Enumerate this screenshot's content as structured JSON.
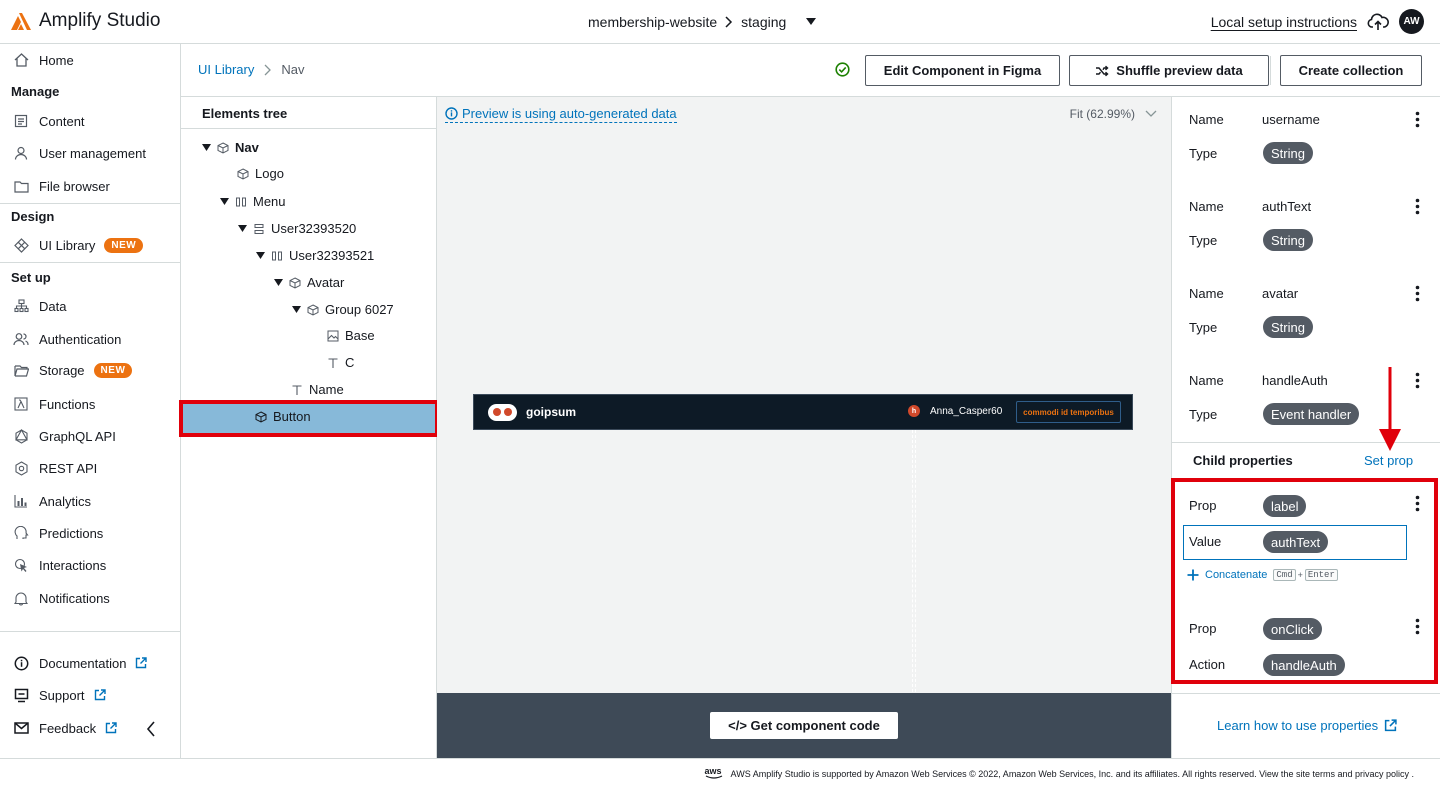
{
  "header": {
    "app_title": "Amplify Studio",
    "project": "membership-website",
    "environment": "staging",
    "setup_link": "Local setup instructions",
    "user_initials": "AW"
  },
  "sidebar": {
    "home": "Home",
    "manage_section": "Manage",
    "manage_items": [
      "Content",
      "User management",
      "File browser"
    ],
    "design_section": "Design",
    "ui_library": "UI Library",
    "ui_library_badge": "NEW",
    "setup_section": "Set up",
    "setup_items": [
      "Data",
      "Authentication",
      "Storage",
      "Functions",
      "GraphQL API",
      "REST API",
      "Analytics",
      "Predictions",
      "Interactions",
      "Notifications"
    ],
    "storage_badge": "NEW",
    "bottom_items": [
      "Documentation",
      "Support",
      "Feedback"
    ]
  },
  "breadcrumb": {
    "root": "UI Library",
    "current": "Nav"
  },
  "toolbar": {
    "edit_figma": "Edit Component in Figma",
    "shuffle": "Shuffle preview data",
    "create_collection": "Create collection"
  },
  "tree": {
    "title": "Elements tree",
    "nodes": [
      "Nav",
      "Logo",
      "Menu",
      "User32393520",
      "User32393521",
      "Avatar",
      "Group 6027",
      "Base",
      "C",
      "Name",
      "Button"
    ]
  },
  "canvas": {
    "preview_note": "Preview is using auto-generated data",
    "zoom": "Fit (62.99%)",
    "nav_logo_text": "goipsum",
    "nav_avatar_letter": "h",
    "nav_username": "Anna_Casper60",
    "nav_button_text": "commodi id temporibus",
    "get_code": "</> Get component code"
  },
  "properties": {
    "name_label": "Name",
    "type_label": "Type",
    "items": [
      {
        "name": "username",
        "type": "String"
      },
      {
        "name": "authText",
        "type": "String"
      },
      {
        "name": "avatar",
        "type": "String"
      },
      {
        "name": "handleAuth",
        "type": "Event handler"
      }
    ],
    "child_title": "Child properties",
    "set_prop": "Set prop",
    "prop_label": "Prop",
    "value_label": "Value",
    "action_label": "Action",
    "child1": {
      "prop": "label",
      "value": "authText"
    },
    "concatenate": "Concatenate",
    "kbd_cmd": "Cmd",
    "kbd_plus": "+",
    "kbd_enter": "Enter",
    "child2": {
      "prop": "onClick",
      "action": "handleAuth"
    },
    "learn": "Learn how to use properties"
  },
  "footer": {
    "aws_mark": "aws",
    "text": "AWS Amplify Studio is supported by Amazon Web Services © 2022, Amazon Web Services, Inc. and its affiliates. All rights reserved. View the site terms and privacy policy ."
  },
  "colors": {
    "link": "#0073bb",
    "badge": "#ec7211",
    "highlight": "#e0000b",
    "selected_row": "#87b9d9"
  }
}
